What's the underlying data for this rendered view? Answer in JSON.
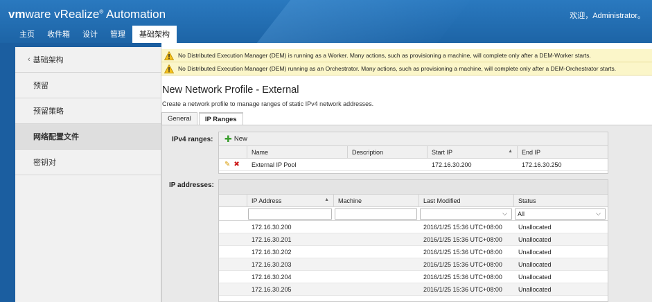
{
  "banner": {
    "logo_prefix": "vm",
    "logo_suffix": "ware",
    "product": " vRealize",
    "trademark": "®",
    "product2": " Automation",
    "user_greeting": "欢迎，Administrator。"
  },
  "nav": {
    "tabs": [
      {
        "label": "主页"
      },
      {
        "label": "收件箱"
      },
      {
        "label": "设计"
      },
      {
        "label": "管理"
      },
      {
        "label": "基础架构"
      }
    ],
    "active_index": 4
  },
  "sidebar": {
    "back_label": "基础架构",
    "items": [
      {
        "label": "预留"
      },
      {
        "label": "预留策略"
      },
      {
        "label": "网络配置文件"
      },
      {
        "label": "密钥对"
      }
    ]
  },
  "warnings": [
    {
      "text": "No Distributed Execution Manager (DEM) is running as a Worker. Many actions, such as provisioning a machine, will complete only after a DEM-Worker starts."
    },
    {
      "text": "No Distributed Execution Manager (DEM) running as an Orchestrator. Many actions, such as provisioning a machine, will complete only after a DEM-Orchestrator starts."
    }
  ],
  "page": {
    "title": "New Network Profile - External",
    "description": "Create a network profile to manage ranges of static IPv4 network addresses."
  },
  "tabs": [
    {
      "label": "General"
    },
    {
      "label": "IP Ranges"
    }
  ],
  "ipv4": {
    "section_label": "IPv4 ranges:",
    "new_label": "New",
    "columns": [
      "Name",
      "Description",
      "Start IP",
      "End IP"
    ],
    "rows": [
      {
        "name": "External IP Pool",
        "description": "",
        "start_ip": "172.16.30.200",
        "end_ip": "172.16.30.250"
      }
    ]
  },
  "ip_addresses": {
    "section_label": "IP addresses:",
    "columns": [
      "IP Address",
      "Machine",
      "Last Modified",
      "Status"
    ],
    "status_filter": "All",
    "rows": [
      {
        "ip": "172.16.30.200",
        "machine": "",
        "modified": "2016/1/25 15:36 UTC+08:00",
        "status": "Unallocated"
      },
      {
        "ip": "172.16.30.201",
        "machine": "",
        "modified": "2016/1/25 15:36 UTC+08:00",
        "status": "Unallocated"
      },
      {
        "ip": "172.16.30.202",
        "machine": "",
        "modified": "2016/1/25 15:36 UTC+08:00",
        "status": "Unallocated"
      },
      {
        "ip": "172.16.30.203",
        "machine": "",
        "modified": "2016/1/25 15:36 UTC+08:00",
        "status": "Unallocated"
      },
      {
        "ip": "172.16.30.204",
        "machine": "",
        "modified": "2016/1/25 15:36 UTC+08:00",
        "status": "Unallocated"
      },
      {
        "ip": "172.16.30.205",
        "machine": "",
        "modified": "2016/1/25 15:36 UTC+08:00",
        "status": "Unallocated"
      }
    ]
  }
}
